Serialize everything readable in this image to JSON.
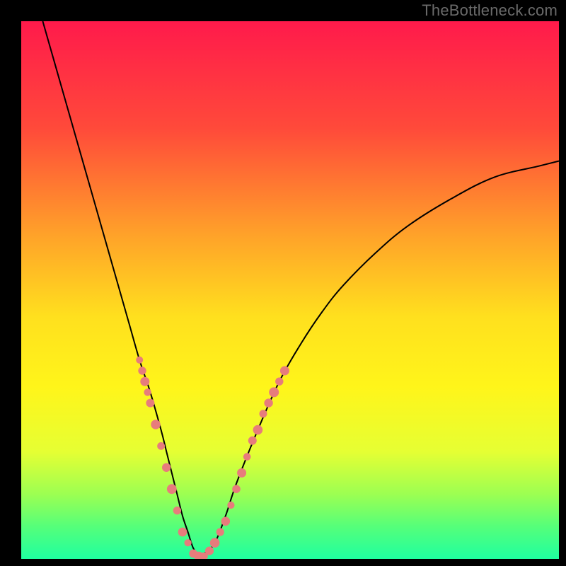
{
  "attribution": "TheBottleneck.com",
  "chart_data": {
    "type": "line",
    "title": "",
    "xlabel": "",
    "ylabel": "",
    "xlim": [
      0,
      100
    ],
    "ylim": [
      0,
      100
    ],
    "gradient_background": {
      "stops": [
        {
          "offset": 0.0,
          "color": "#ff1a4b"
        },
        {
          "offset": 0.2,
          "color": "#ff4a3a"
        },
        {
          "offset": 0.4,
          "color": "#ffa329"
        },
        {
          "offset": 0.55,
          "color": "#ffe01e"
        },
        {
          "offset": 0.68,
          "color": "#fff51a"
        },
        {
          "offset": 0.8,
          "color": "#e6ff33"
        },
        {
          "offset": 0.88,
          "color": "#9cff52"
        },
        {
          "offset": 0.94,
          "color": "#55ff7a"
        },
        {
          "offset": 1.0,
          "color": "#1fffa0"
        }
      ]
    },
    "series": [
      {
        "name": "bottleneck-curve",
        "color": "#000000",
        "width": 2,
        "x": [
          4,
          6,
          8,
          10,
          12,
          14,
          16,
          18,
          20,
          22,
          24,
          26,
          27,
          28,
          29,
          30,
          31,
          32,
          33,
          34,
          36,
          38,
          40,
          44,
          48,
          52,
          56,
          60,
          66,
          72,
          80,
          88,
          96,
          100
        ],
        "y": [
          100,
          93,
          86,
          79,
          72,
          65,
          58,
          51,
          44,
          37,
          31,
          24,
          20,
          16,
          12,
          8,
          5,
          2,
          1,
          1,
          3,
          8,
          14,
          24,
          33,
          40,
          46,
          51,
          57,
          62,
          67,
          71,
          73,
          74
        ]
      }
    ],
    "markers": {
      "color": "#e77c7c",
      "radius_range": [
        5,
        7
      ],
      "points": [
        {
          "x": 22.0,
          "y": 37
        },
        {
          "x": 22.5,
          "y": 35
        },
        {
          "x": 23.0,
          "y": 33
        },
        {
          "x": 23.5,
          "y": 31
        },
        {
          "x": 24.0,
          "y": 29
        },
        {
          "x": 25.0,
          "y": 25
        },
        {
          "x": 26.0,
          "y": 21
        },
        {
          "x": 27.0,
          "y": 17
        },
        {
          "x": 28.0,
          "y": 13
        },
        {
          "x": 29.0,
          "y": 9
        },
        {
          "x": 30.0,
          "y": 5
        },
        {
          "x": 31.0,
          "y": 3
        },
        {
          "x": 32.0,
          "y": 1
        },
        {
          "x": 33.0,
          "y": 0.5
        },
        {
          "x": 34.0,
          "y": 0.5
        },
        {
          "x": 35.0,
          "y": 1.5
        },
        {
          "x": 36.0,
          "y": 3
        },
        {
          "x": 37.0,
          "y": 5
        },
        {
          "x": 38.0,
          "y": 7
        },
        {
          "x": 39.0,
          "y": 10
        },
        {
          "x": 40.0,
          "y": 13
        },
        {
          "x": 41.0,
          "y": 16
        },
        {
          "x": 42.0,
          "y": 19
        },
        {
          "x": 43.0,
          "y": 22
        },
        {
          "x": 44.0,
          "y": 24
        },
        {
          "x": 45.0,
          "y": 27
        },
        {
          "x": 46.0,
          "y": 29
        },
        {
          "x": 47.0,
          "y": 31
        },
        {
          "x": 48.0,
          "y": 33
        },
        {
          "x": 49.0,
          "y": 35
        }
      ]
    }
  }
}
